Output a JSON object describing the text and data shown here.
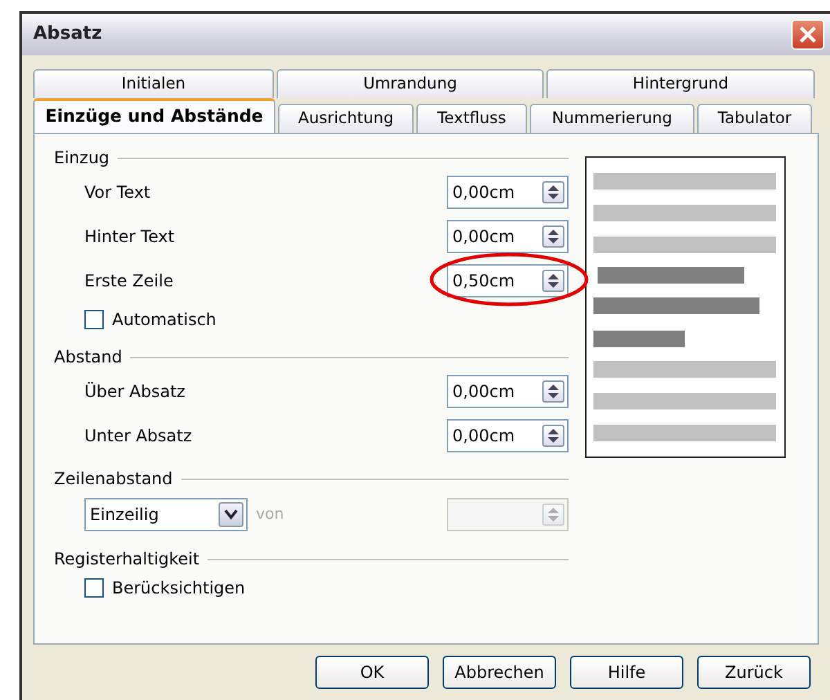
{
  "window": {
    "title": "Absatz"
  },
  "tabs_row_1": [
    {
      "label": "Initialen",
      "selected": false
    },
    {
      "label": "Umrandung",
      "selected": false
    },
    {
      "label": "Hintergrund",
      "selected": false
    }
  ],
  "tabs_row_2": [
    {
      "label": "Einzüge und Abstände",
      "selected": true
    },
    {
      "label": "Ausrichtung",
      "selected": false
    },
    {
      "label": "Textfluss",
      "selected": false
    },
    {
      "label": "Nummerierung",
      "selected": false
    },
    {
      "label": "Tabulator",
      "selected": false
    }
  ],
  "sections": [
    {
      "heading": "Einzug",
      "items": [
        {
          "kind": "spin",
          "label": "Vor Text",
          "value": "0,00cm",
          "circled": false
        },
        {
          "kind": "spin",
          "label": "Hinter Text",
          "value": "0,00cm",
          "circled": false
        },
        {
          "kind": "spin",
          "label": "Erste Zeile",
          "value": "0,50cm",
          "circled": true
        },
        {
          "kind": "checkbox",
          "label": "Automatisch",
          "checked": false
        }
      ]
    },
    {
      "heading": "Abstand",
      "items": [
        {
          "kind": "spin",
          "label": "Über Absatz",
          "value": "0,00cm",
          "circled": false
        },
        {
          "kind": "spin",
          "label": "Unter Absatz",
          "value": "0,00cm",
          "circled": false
        }
      ]
    },
    {
      "heading": "Zeilenabstand",
      "items": [
        {
          "kind": "combo",
          "value": "Einzeilig",
          "label": "von",
          "disabled": true
        }
      ]
    },
    {
      "heading": "Registerhaltigkeit",
      "items": [
        {
          "kind": "checkbox",
          "label": "Berücksichtigen",
          "checked": false
        }
      ]
    }
  ],
  "buttons": [
    {
      "label": "OK"
    },
    {
      "label": "Abbrechen"
    },
    {
      "label": "Hilfe"
    },
    {
      "label": "Zurück"
    }
  ]
}
